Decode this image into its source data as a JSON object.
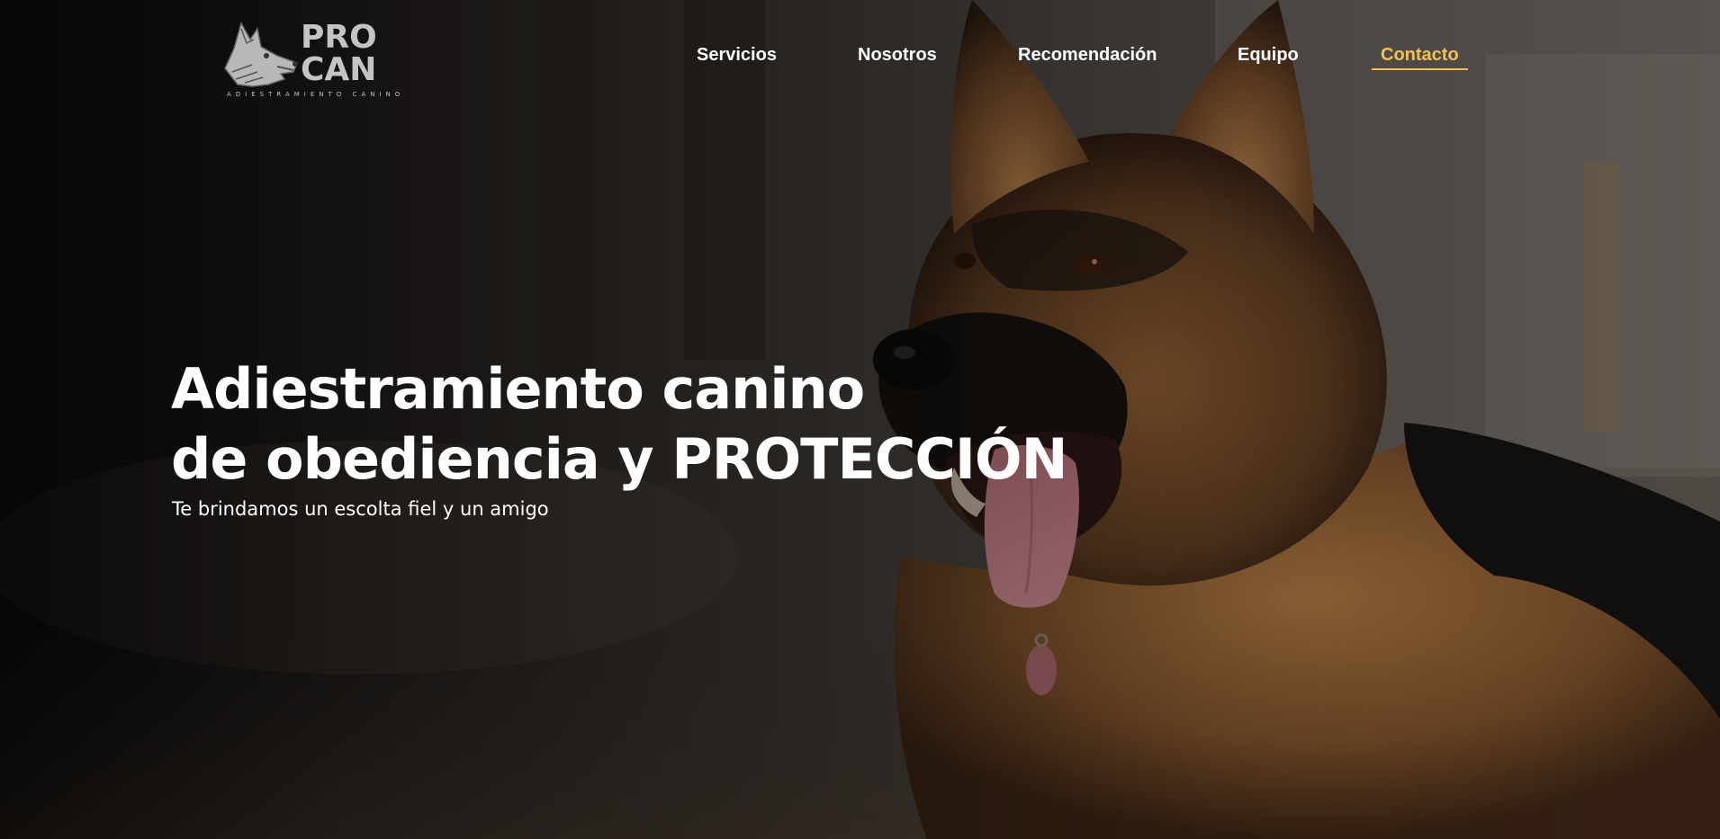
{
  "brand": {
    "logo_line1": "PRO",
    "logo_line2": "CAN",
    "logo_subtitle": "ADIESTRAMIENTO CANINO",
    "logo_icon": "dog-head-icon"
  },
  "nav": {
    "items": [
      {
        "label": "Servicios",
        "active": false
      },
      {
        "label": "Nosotros",
        "active": false
      },
      {
        "label": "Recomendación",
        "active": false
      },
      {
        "label": "Equipo",
        "active": false
      },
      {
        "label": "Contacto",
        "active": true
      }
    ]
  },
  "hero": {
    "headline_line1": "Adiestramiento canino",
    "headline_line2": "de obediencia y PROTECCIÓN",
    "tagline": "Te brindamos un escolta fiel y un amigo",
    "background_image": "german-shepherd-dog-photo"
  },
  "colors": {
    "accent": "#f2c14e",
    "text": "#ffffff",
    "logo_gray": "#b8b8b8"
  }
}
